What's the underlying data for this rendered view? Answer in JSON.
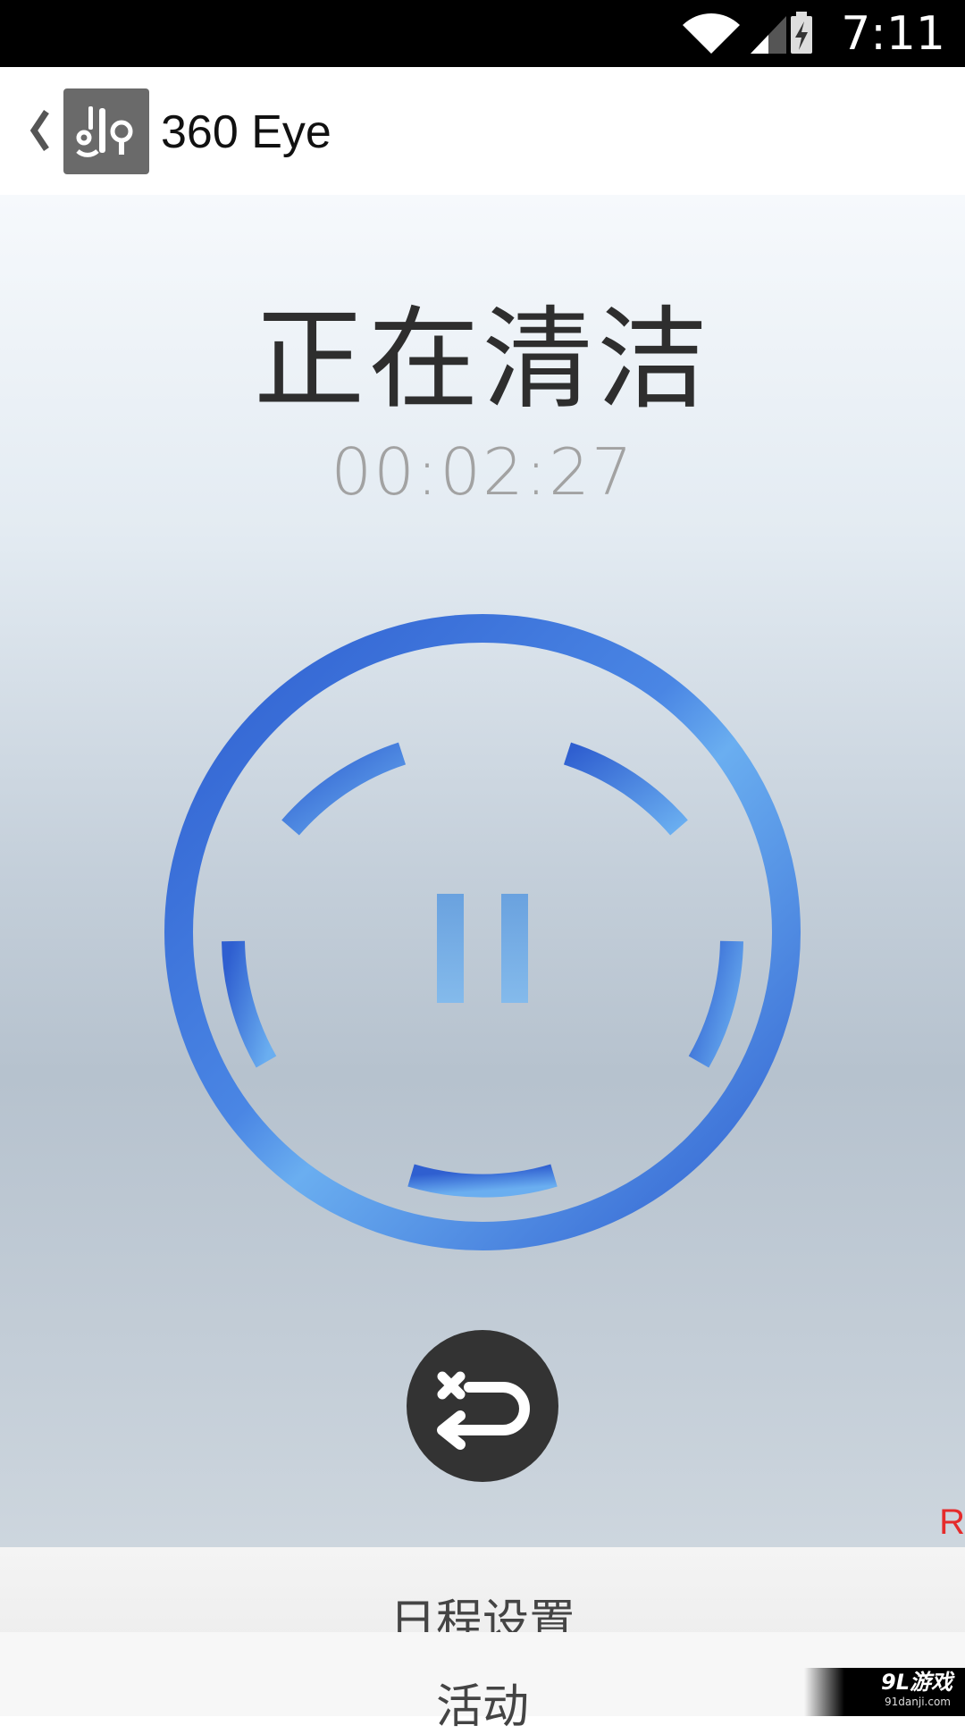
{
  "status_bar": {
    "time": "7:11"
  },
  "header": {
    "app_title": "360 Eye"
  },
  "main": {
    "status_title": "正在清洁",
    "elapsed_time": "00:02:27"
  },
  "bottom_sheets": [
    {
      "label": "日程设置"
    },
    {
      "label": "活动"
    }
  ],
  "edge_text": "R",
  "watermark": {
    "brand": "9L游戏",
    "site": "91danji.com"
  },
  "icons": {
    "back": "chevron-left-icon",
    "logo": "360-eye-logo",
    "pause": "pause-icon",
    "return_home": "return-dock-icon",
    "wifi": "wifi-icon",
    "signal": "signal-icon",
    "battery": "battery-charging-icon"
  },
  "colors": {
    "ring_dark": "#2f5fd0",
    "ring_light": "#6aaef0",
    "title_text": "#2e2e2e",
    "timer_text": "#a2a2a2",
    "return_button": "#333333"
  }
}
